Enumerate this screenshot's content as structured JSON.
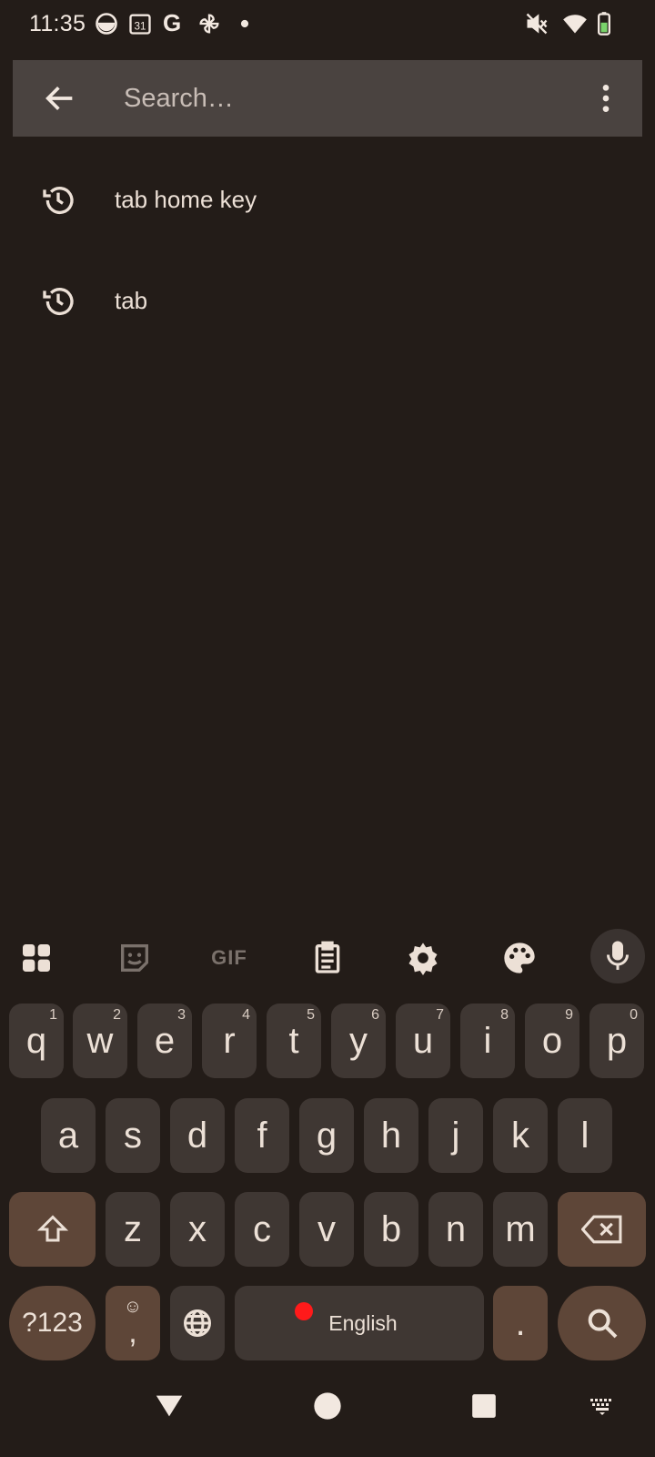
{
  "status_bar": {
    "time": "11:35",
    "left_icons": [
      "weather-icon",
      "calendar-icon",
      "google-icon",
      "pinwheel-icon",
      "dot-icon"
    ],
    "calendar_day": "31",
    "google_letter": "G",
    "right_icons": [
      "mute-icon",
      "wifi-icon",
      "battery-icon"
    ]
  },
  "search": {
    "placeholder": "Search…",
    "value": ""
  },
  "history": [
    {
      "label": "tab home key",
      "icon": "history-icon"
    },
    {
      "label": "tab",
      "icon": "history-icon"
    }
  ],
  "keyboard": {
    "toolbar": [
      "apps-grid-icon",
      "sticker-icon",
      "gif",
      "clipboard-icon",
      "settings-icon",
      "palette-icon",
      "mic-icon"
    ],
    "gif_label": "GIF",
    "row1": [
      {
        "key": "q",
        "hint": "1"
      },
      {
        "key": "w",
        "hint": "2"
      },
      {
        "key": "e",
        "hint": "3"
      },
      {
        "key": "r",
        "hint": "4"
      },
      {
        "key": "t",
        "hint": "5"
      },
      {
        "key": "y",
        "hint": "6"
      },
      {
        "key": "u",
        "hint": "7"
      },
      {
        "key": "i",
        "hint": "8"
      },
      {
        "key": "o",
        "hint": "9"
      },
      {
        "key": "p",
        "hint": "0"
      }
    ],
    "row2": [
      "a",
      "s",
      "d",
      "f",
      "g",
      "h",
      "j",
      "k",
      "l"
    ],
    "row3": [
      "z",
      "x",
      "c",
      "v",
      "b",
      "n",
      "m"
    ],
    "symbols_label": "?123",
    "comma_label": ",",
    "emoji_label": "☺",
    "space_label": "English",
    "period_label": ".",
    "colors": {
      "key": "#3f3733",
      "function_key": "#5e4638",
      "recording_dot": "#ff1a1a"
    }
  },
  "nav_bar": [
    "back-triangle-icon",
    "home-circle-icon",
    "recents-square-icon",
    "keyboard-switch-icon"
  ]
}
